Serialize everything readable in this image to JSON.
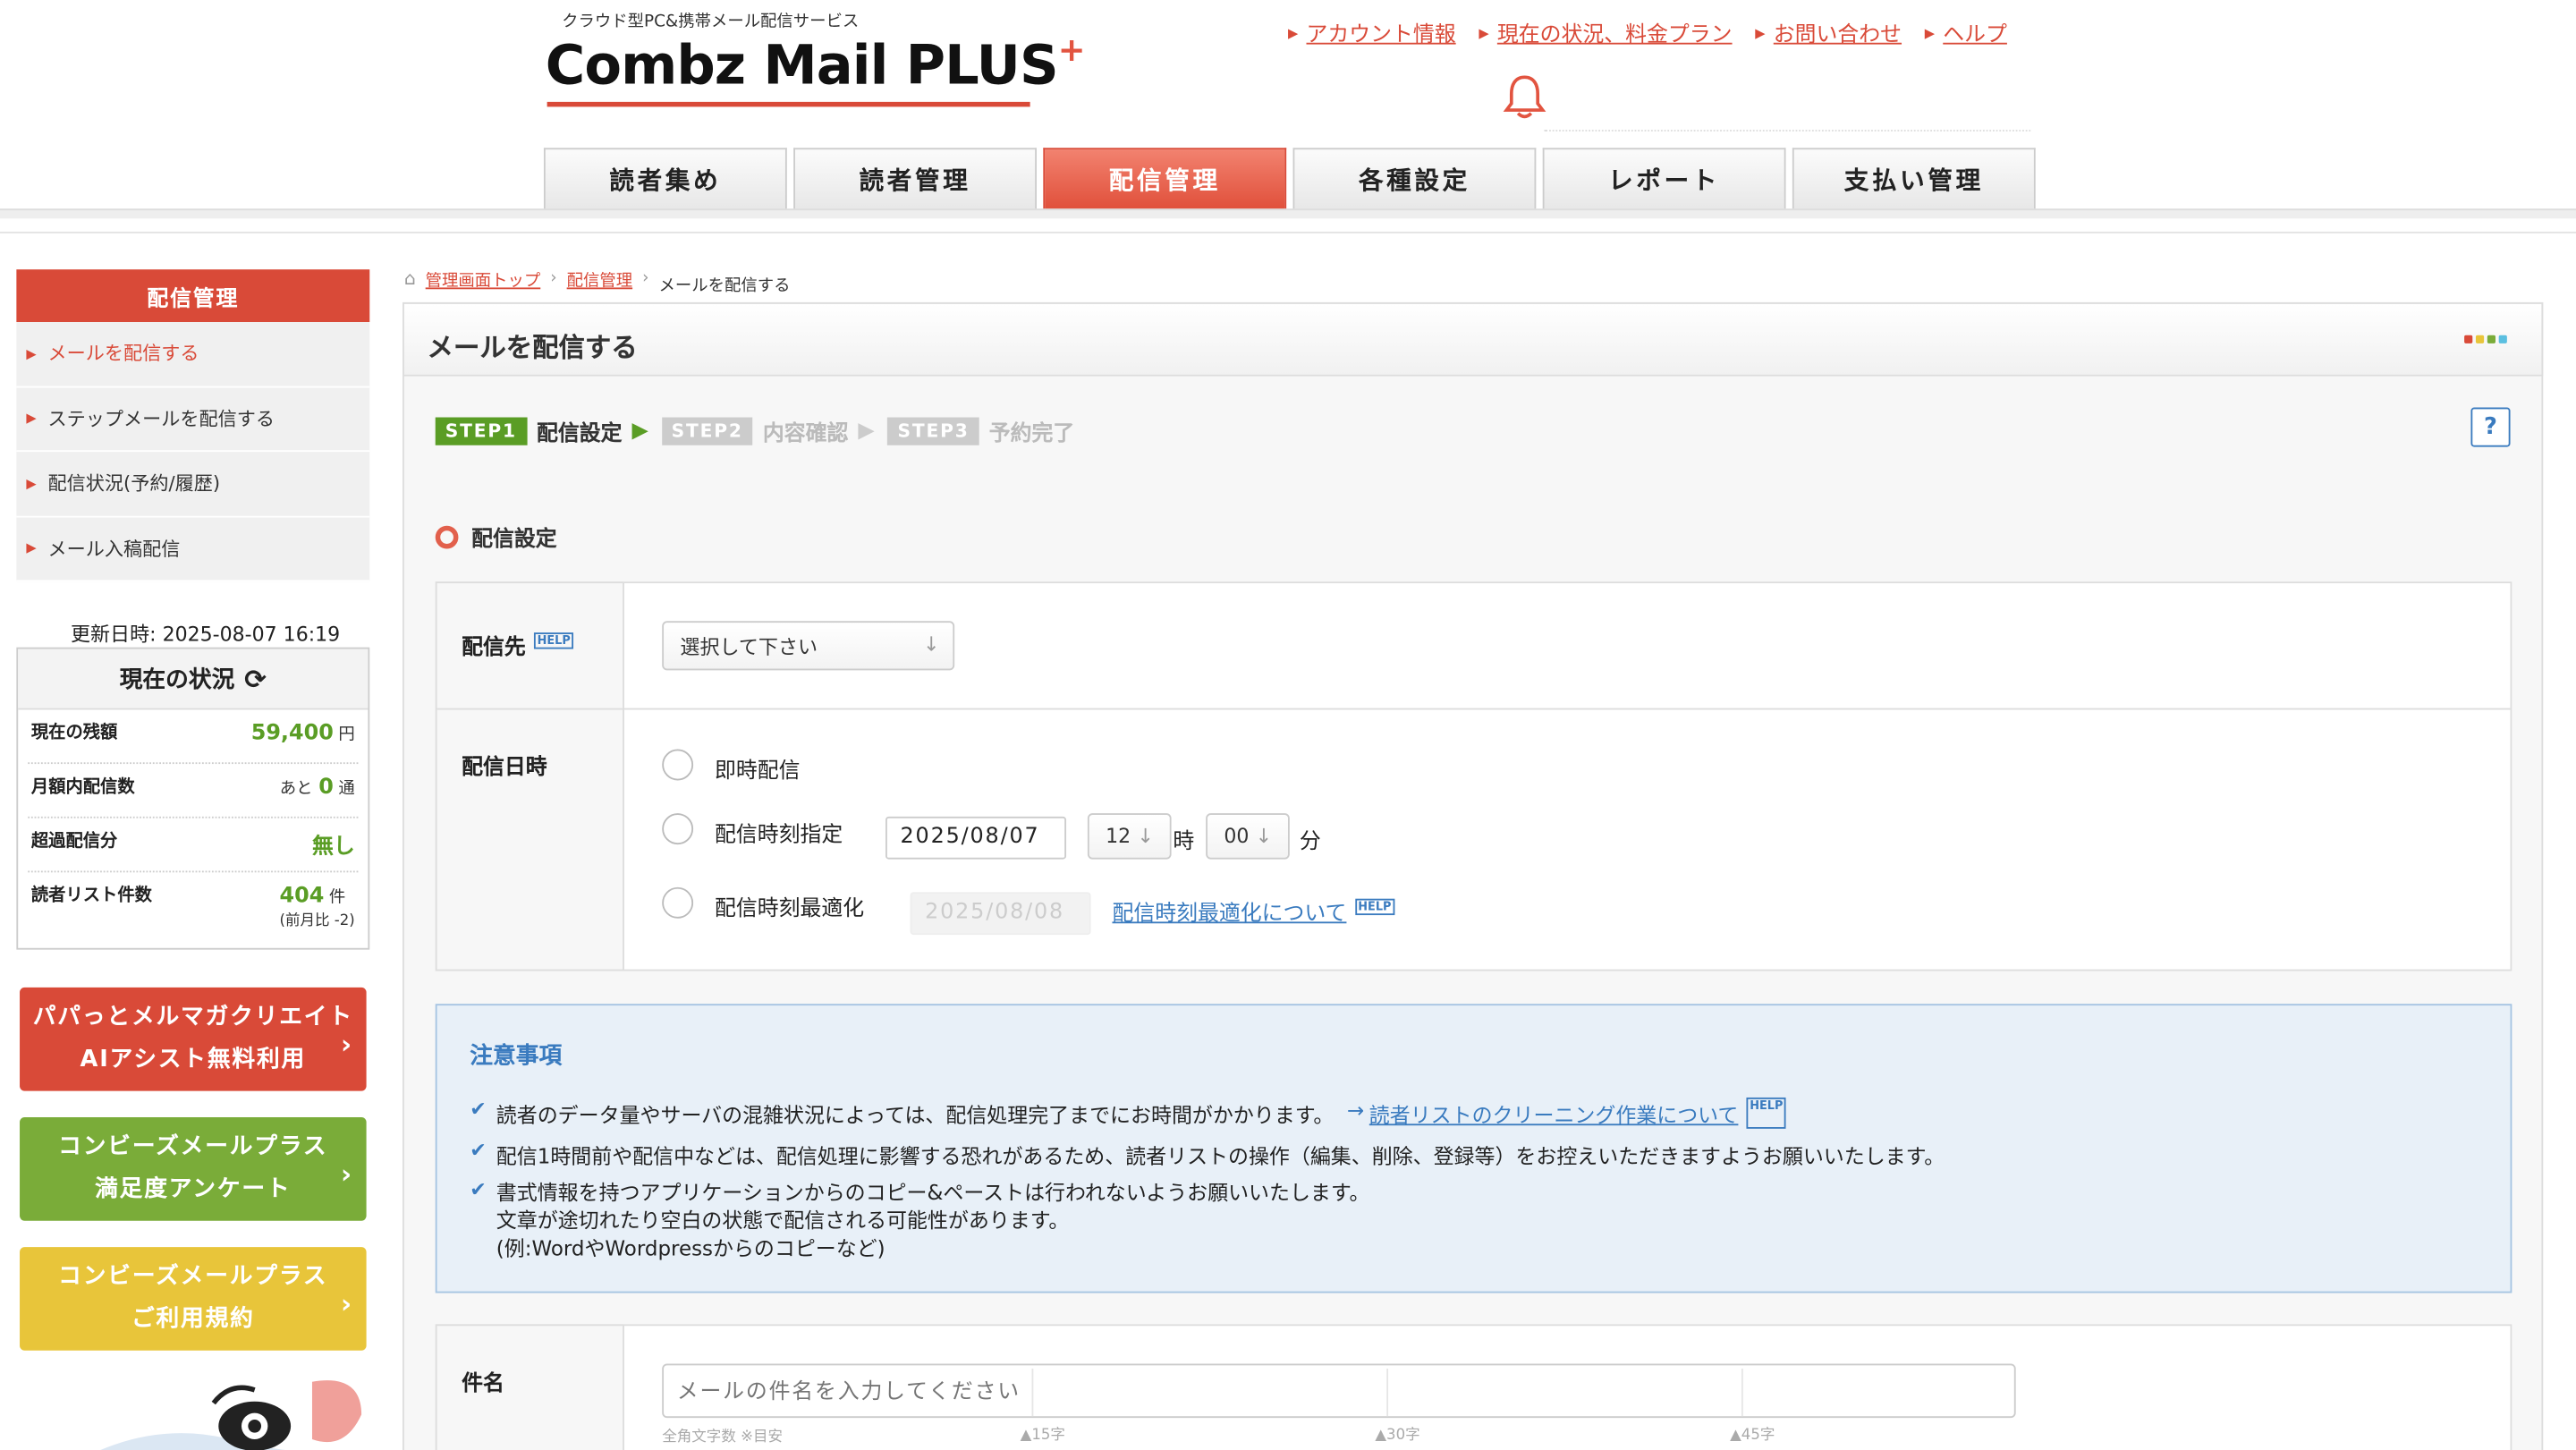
{
  "header": {
    "tagline": "クラウド型PC&携帯メール配信サービス",
    "logo": "Combz Mail PLUS",
    "logo_plus": "+",
    "links": [
      "アカウント情報",
      "現在の状況、料金プラン",
      "お問い合わせ",
      "ヘルプ"
    ]
  },
  "nav": {
    "tabs": [
      "読者集め",
      "読者管理",
      "配信管理",
      "各種設定",
      "レポート",
      "支払い管理"
    ],
    "active": "配信管理"
  },
  "sidebar": {
    "title": "配信管理",
    "items": [
      "メールを配信する",
      "ステップメールを配信する",
      "配信状況(予約/履歴)",
      "メール入稿配信"
    ],
    "updated": "更新日時: 2025-08-07 16:19",
    "status": {
      "title": "現在の状況",
      "rows": [
        {
          "label": "現在の残額",
          "value": "59,400",
          "unit": "円"
        },
        {
          "label": "月額内配信数",
          "prefix": "あと",
          "value": "0",
          "unit": "通"
        },
        {
          "label": "超過配信分",
          "value": "無し"
        },
        {
          "label": "読者リスト件数",
          "value": "404",
          "unit": "件",
          "sub": "(前月比 -2)"
        }
      ]
    },
    "banners": [
      {
        "line1": "パパっとメルマガクリエイト",
        "line2": "AIアシスト無料利用"
      },
      {
        "line1": "コンビーズメールプラス",
        "line2": "満足度アンケート"
      },
      {
        "line1": "コンビーズメールプラス",
        "line2": "ご利用規約"
      }
    ]
  },
  "breadcrumb": [
    "管理画面トップ",
    "配信管理",
    "メールを配信する"
  ],
  "page": {
    "title": "メールを配信する",
    "steps": [
      {
        "badge": "STEP1",
        "label": "配信設定"
      },
      {
        "badge": "STEP2",
        "label": "内容確認"
      },
      {
        "badge": "STEP3",
        "label": "予約完了"
      }
    ],
    "help": "?",
    "section_title": "配信設定",
    "help_tag": "HELP"
  },
  "form": {
    "destination_label": "配信先",
    "destination_select": "選択して下さい",
    "datetime_label": "配信日時",
    "opt_immediate": "即時配信",
    "opt_scheduled": "配信時刻指定",
    "scheduled_date": "2025/08/07",
    "hour": "12",
    "hour_unit": "時",
    "minute": "00",
    "minute_unit": "分",
    "opt_optimize": "配信時刻最適化",
    "optimize_date": "2025/08/08",
    "optimize_link": "配信時刻最適化について"
  },
  "notice": {
    "title": "注意事項",
    "item1": "読者のデータ量やサーバの混雑状況によっては、配信処理完了までにお時間がかかります。",
    "item1_link": "読者リストのクリーニング作業について",
    "item2": "配信1時間前や配信中などは、配信処理に影響する恐れがあるため、読者リストの操作（編集、削除、登録等）をお控えいただきますようお願いいたします。",
    "item3_l1": "書式情報を持つアプリケーションからのコピー&ペーストは行われないようお願いいたします。",
    "item3_l2": "文章が途切れたり空白の状態で配信される可能性があります。",
    "item3_l3": "(例:WordやWordpressからのコピーなど)"
  },
  "subject": {
    "label": "件名",
    "placeholder": "メールの件名を入力してください",
    "counter_note": "全角文字数 ※目安",
    "marks": [
      "15字",
      "30字",
      "45字"
    ]
  },
  "colors": {
    "accent": "#d94a38",
    "green": "#5a9d25",
    "blue": "#3a7bbf",
    "yellow": "#e8c53a"
  }
}
